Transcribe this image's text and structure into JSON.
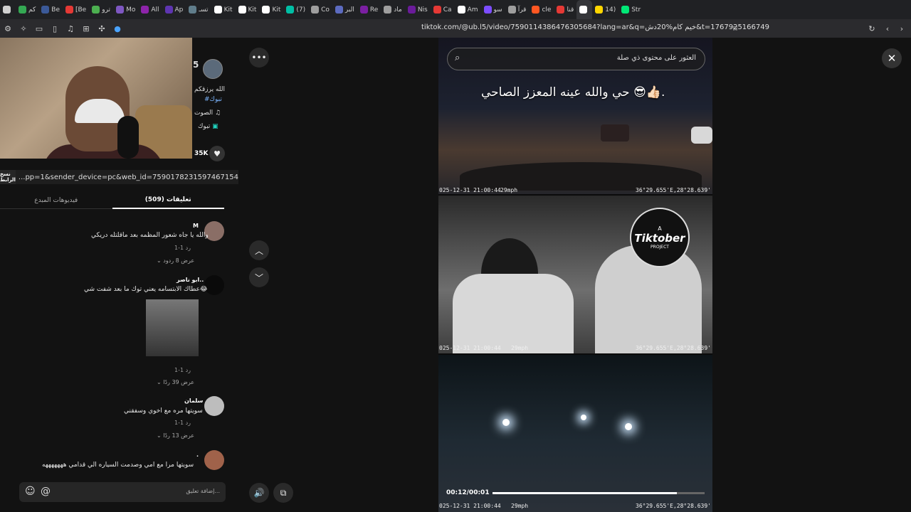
{
  "browser": {
    "tabs": [
      {
        "label": "",
        "color": "#d0d0d0"
      },
      {
        "label": "كم",
        "color": "#34a853"
      },
      {
        "label": "Be",
        "color": "#3b5998"
      },
      {
        "label": "[Be",
        "color": "#e53935"
      },
      {
        "label": "ترو",
        "color": "#4caf50"
      },
      {
        "label": "Mo",
        "color": "#7e57c2"
      },
      {
        "label": "All",
        "color": "#8e24aa"
      },
      {
        "label": "Ap",
        "color": "#5e35b1"
      },
      {
        "label": "تسـ",
        "color": "#607d8b"
      },
      {
        "label": "Kit",
        "color": "#ffffff"
      },
      {
        "label": "Kit",
        "color": "#ffffff"
      },
      {
        "label": "Kit",
        "color": "#ffffff"
      },
      {
        "label": "(7)",
        "color": "#00bfa5"
      },
      {
        "label": "Co",
        "color": "#9e9e9e"
      },
      {
        "label": "البر",
        "color": "#5c6bc0"
      },
      {
        "label": "Re",
        "color": "#7b1fa2"
      },
      {
        "label": "ماد",
        "color": "#9e9e9e"
      },
      {
        "label": "Nis",
        "color": "#6a1b9a"
      },
      {
        "label": "Ca",
        "color": "#e53935"
      },
      {
        "label": "Am",
        "color": "#ffffff"
      },
      {
        "label": "سو",
        "color": "#7c4dff"
      },
      {
        "label": "قرآ",
        "color": "#9e9e9e"
      },
      {
        "label": "cle",
        "color": "#ff5722"
      },
      {
        "label": "قنا",
        "color": "#e53935"
      },
      {
        "label": "",
        "color": "#ffffff",
        "active": true
      },
      {
        "label": "14)",
        "color": "#ffd600"
      },
      {
        "label": "Str",
        "color": "#00e676"
      }
    ],
    "url": "tiktok.com/@ub.l5/video/7590114386476305684?lang=ar&q=خيم كام%20دش&t=1767925166749"
  },
  "post": {
    "author_fragment": "5",
    "desc_line1": "الله يرزقكم",
    "hashtag": "#تبوك",
    "sound": "الصوت",
    "location": "تبوك",
    "likes": "35K",
    "copy_link_label": "نسخ الرابط",
    "link": "...pp=1&sender_device=pc&web_id=7590178231597467154",
    "tab_comments": "تعليقات (509)",
    "tab_creator_videos": "فيديوهات المبدع"
  },
  "comments": [
    {
      "name": "M",
      "text": "والله يا جاه شعور المظمه بعد ماقلتله دريكي",
      "meta": "1-1    رد",
      "more": "عرض 8 ردود"
    },
    {
      "name": "ابو ناصر..",
      "text": "عطاك الابتسامه يعني توك ما بعد شفت شي😂",
      "meta": "1-1    رد",
      "more": "عرض 39 ردًا"
    },
    {
      "name": "سلمان",
      "text": "سويتها مره مع اخوي وسفقني",
      "meta": "1-1    رد",
      "more": "عرض 13 ردًا"
    },
    {
      "name": ".",
      "text": "سويتها مرا مع امي وصدمت السياره الي قدامي هههههههه",
      "meta": "",
      "more": ""
    }
  ],
  "composer": {
    "placeholder": "إضافة تعليق..."
  },
  "video": {
    "search_placeholder": "العثور على محتوى ذي صلة",
    "caption": "حي والله عينه المعزز الصاحي 😎👍🏻.",
    "stamp_left": "025-12-31 21:00:44",
    "stamp_speed": "29mph",
    "stamp_gps": "36°29.655'E,28°28.639'",
    "logo_a": "A",
    "logo_name": "Tiktober",
    "logo_project": "PROJECT",
    "time": "00:12/00:01",
    "progress": 0.87
  }
}
